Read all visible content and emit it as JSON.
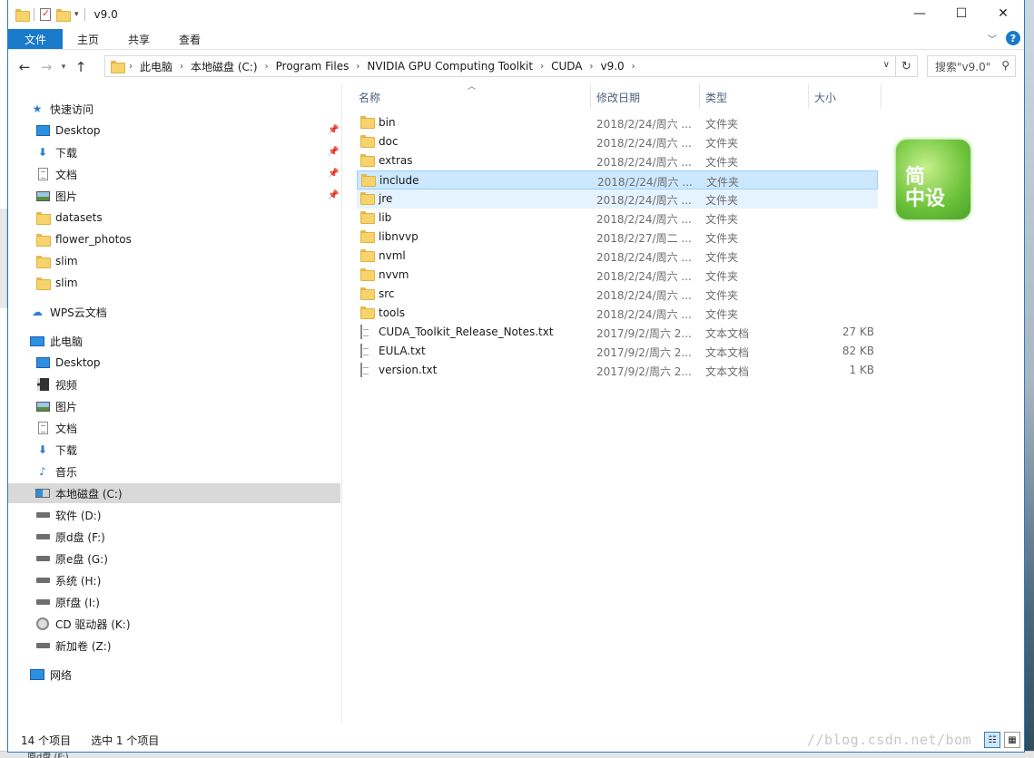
{
  "window": {
    "title": "v9.0",
    "controls": [
      "—",
      "☐",
      "✕"
    ]
  },
  "ribbon": {
    "tabs": [
      "文件",
      "主页",
      "共享",
      "查看"
    ],
    "help": "?"
  },
  "address": {
    "crumbs": [
      "此电脑",
      "本地磁盘 (C:)",
      "Program Files",
      "NVIDIA GPU Computing Toolkit",
      "CUDA",
      "v9.0"
    ],
    "search_placeholder": "搜索\"v9.0\""
  },
  "sidebar": {
    "quick_access": "快速访问",
    "quick_items": [
      {
        "label": "Desktop",
        "icon": "desktop-icon"
      },
      {
        "label": "下载",
        "icon": "download-icon"
      },
      {
        "label": "文档",
        "icon": "document-icon"
      },
      {
        "label": "图片",
        "icon": "picture-icon"
      },
      {
        "label": "datasets",
        "icon": "folder-icon"
      },
      {
        "label": "flower_photos",
        "icon": "folder-icon"
      },
      {
        "label": "slim",
        "icon": "folder-icon"
      },
      {
        "label": "slim",
        "icon": "folder-icon"
      }
    ],
    "wps": "WPS云文档",
    "this_pc": "此电脑",
    "pc_items": [
      {
        "label": "Desktop",
        "icon": "desktop-icon"
      },
      {
        "label": "视频",
        "icon": "video-icon"
      },
      {
        "label": "图片",
        "icon": "picture-icon"
      },
      {
        "label": "文档",
        "icon": "document-icon"
      },
      {
        "label": "下载",
        "icon": "download-icon"
      },
      {
        "label": "音乐",
        "icon": "music-icon"
      },
      {
        "label": "本地磁盘 (C:)",
        "icon": "system-drive-icon"
      },
      {
        "label": "软件 (D:)",
        "icon": "drive-icon"
      },
      {
        "label": "原d盘 (F:)",
        "icon": "drive-icon"
      },
      {
        "label": "原e盘 (G:)",
        "icon": "drive-icon"
      },
      {
        "label": "系统 (H:)",
        "icon": "drive-icon"
      },
      {
        "label": "原f盘 (I:)",
        "icon": "drive-icon"
      },
      {
        "label": "CD 驱动器 (K:)",
        "icon": "cd-drive-icon"
      },
      {
        "label": "新加卷 (Z:)",
        "icon": "drive-icon"
      }
    ],
    "network": "网络"
  },
  "columns": {
    "name": "名称",
    "date": "修改日期",
    "type": "类型",
    "size": "大小"
  },
  "files": [
    {
      "name": "bin",
      "date": "2018/2/24/周六 ...",
      "type": "文件夹",
      "size": "",
      "kind": "folder"
    },
    {
      "name": "doc",
      "date": "2018/2/24/周六 ...",
      "type": "文件夹",
      "size": "",
      "kind": "folder"
    },
    {
      "name": "extras",
      "date": "2018/2/24/周六 ...",
      "type": "文件夹",
      "size": "",
      "kind": "folder"
    },
    {
      "name": "include",
      "date": "2018/2/24/周六 ...",
      "type": "文件夹",
      "size": "",
      "kind": "folder"
    },
    {
      "name": "jre",
      "date": "2018/2/24/周六 ...",
      "type": "文件夹",
      "size": "",
      "kind": "folder"
    },
    {
      "name": "lib",
      "date": "2018/2/24/周六 ...",
      "type": "文件夹",
      "size": "",
      "kind": "folder"
    },
    {
      "name": "libnvvp",
      "date": "2018/2/27/周二 ...",
      "type": "文件夹",
      "size": "",
      "kind": "folder"
    },
    {
      "name": "nvml",
      "date": "2018/2/24/周六 ...",
      "type": "文件夹",
      "size": "",
      "kind": "folder"
    },
    {
      "name": "nvvm",
      "date": "2018/2/24/周六 ...",
      "type": "文件夹",
      "size": "",
      "kind": "folder"
    },
    {
      "name": "src",
      "date": "2018/2/24/周六 ...",
      "type": "文件夹",
      "size": "",
      "kind": "folder"
    },
    {
      "name": "tools",
      "date": "2018/2/24/周六 ...",
      "type": "文件夹",
      "size": "",
      "kind": "folder"
    },
    {
      "name": "CUDA_Toolkit_Release_Notes.txt",
      "date": "2017/9/2/周六 2...",
      "type": "文本文档",
      "size": "27 KB",
      "kind": "text"
    },
    {
      "name": "EULA.txt",
      "date": "2017/9/2/周六 2...",
      "type": "文本文档",
      "size": "82 KB",
      "kind": "text"
    },
    {
      "name": "version.txt",
      "date": "2017/9/2/周六 2...",
      "type": "文本文档",
      "size": "1 KB",
      "kind": "text"
    }
  ],
  "logo_text": [
    "简",
    "中设"
  ],
  "status": {
    "count": "14 个项目",
    "selected": "选中 1 个项目",
    "watermark": "//blog.csdn.net/bom"
  },
  "taskbar_peek": "原d盘 (F:)",
  "colors": {
    "accent": "#1979ca",
    "selection": "#cce8ff",
    "folder": "#f6d36b"
  }
}
